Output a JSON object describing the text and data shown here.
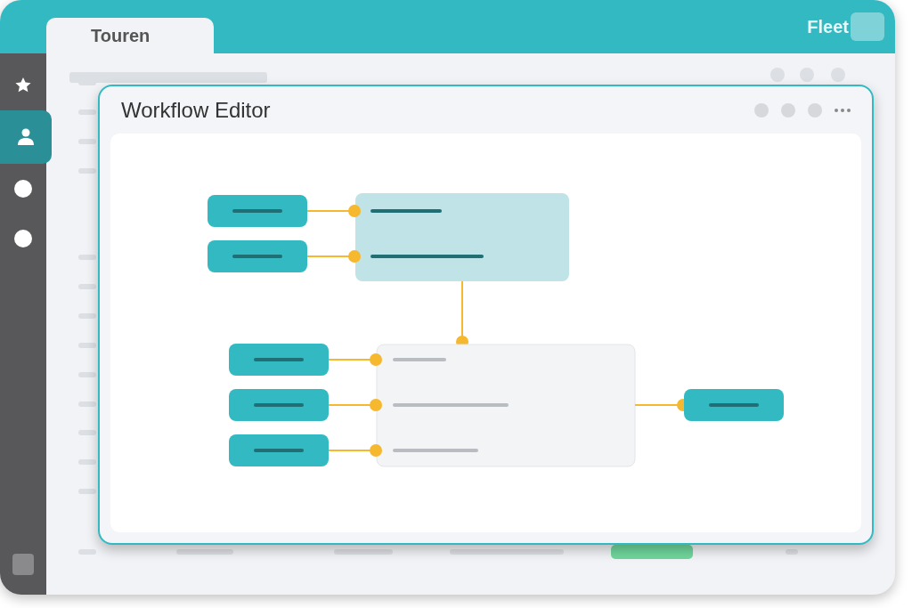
{
  "app": {
    "logo": "Fleet",
    "tabs": [
      {
        "label": "Touren",
        "selected": true
      }
    ]
  },
  "sidebar": {
    "items": [
      {
        "selected": false
      },
      {
        "selected": true
      },
      {
        "selected": false
      },
      {
        "selected": false
      }
    ]
  },
  "editor": {
    "title": "Workflow Editor"
  }
}
